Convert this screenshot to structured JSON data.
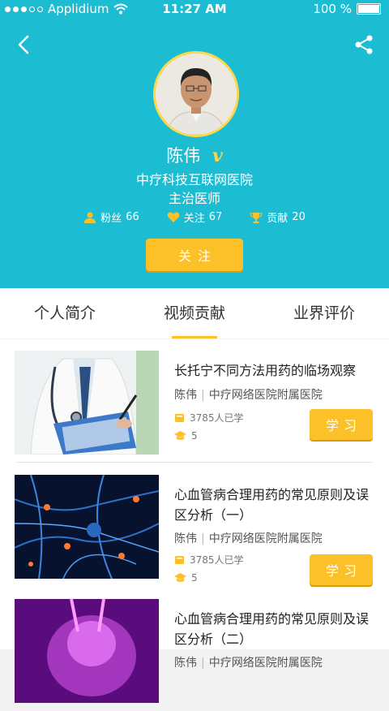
{
  "statusbar": {
    "carrier": "Applidium",
    "time": "11:27 AM",
    "battery": "100 %"
  },
  "profile": {
    "name": "陈伟",
    "badge": "v",
    "hospital": "中疗科技互联网医院",
    "title": "主治医师",
    "stats": [
      {
        "label": "粉丝",
        "value": "66",
        "icon": "person-icon"
      },
      {
        "label": "关注",
        "value": "67",
        "icon": "heart-icon"
      },
      {
        "label": "贡献",
        "value": "20",
        "icon": "trophy-icon"
      }
    ],
    "follow_label": "关注"
  },
  "tabs": [
    {
      "label": "个人简介"
    },
    {
      "label": "视频贡献"
    },
    {
      "label": "业界评价"
    }
  ],
  "active_tab": "视频贡献",
  "courses": [
    {
      "title": "长托宁不同方法用药的临场观察",
      "author": "陈伟",
      "org": "中疗网络医院附属医院",
      "learners": "3785人已学",
      "rating": "5",
      "button": "学习"
    },
    {
      "title": "心血管病合理用药的常见原则及误区分析（一）",
      "author": "陈伟",
      "org": "中疗网络医院附属医院",
      "learners": "3785人已学",
      "rating": "5",
      "button": "学习"
    },
    {
      "title": "心血管病合理用药的常见原则及误区分析（二）",
      "author": "陈伟",
      "org": "中疗网络医院附属医院",
      "learners": "",
      "rating": "",
      "button": ""
    }
  ],
  "colors": {
    "header": "#1cbcd3",
    "accent": "#fcc129"
  }
}
